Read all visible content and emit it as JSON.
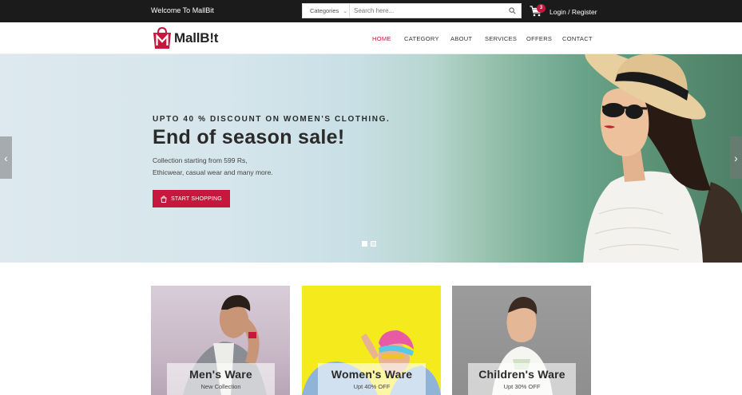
{
  "topbar": {
    "welcome": "Welcome To MallBit",
    "categories_label": "Categories",
    "search_placeholder": "Search here...",
    "cart_count": "3",
    "login": "Login / Register"
  },
  "brand": {
    "logo_text": "MallB!t",
    "primary_color": "#c8173d"
  },
  "nav": {
    "items": [
      {
        "label": "HOME",
        "active": true
      },
      {
        "label": "CATEGORY",
        "active": false
      },
      {
        "label": "ABOUT",
        "active": false
      },
      {
        "label": "SERVICES",
        "active": false
      },
      {
        "label": "OFFERS",
        "active": false
      },
      {
        "label": "CONTACT",
        "active": false
      }
    ]
  },
  "hero": {
    "tagline": "UPTO 40 % DISCOUNT ON WOMEN'S CLOTHING.",
    "title": "End of season sale!",
    "desc_line1": "Collection starting from 599 Rs,",
    "desc_line2": "Ethicwear, casual wear and many more.",
    "button": "START SHOPPING",
    "slides": 2,
    "active_slide": 1
  },
  "categories": [
    {
      "title": "Men's Ware",
      "subtitle": "New Collection"
    },
    {
      "title": "Women's Ware",
      "subtitle": "Upt 40% OFF"
    },
    {
      "title": "Children's Ware",
      "subtitle": "Upt 30% OFF"
    }
  ]
}
